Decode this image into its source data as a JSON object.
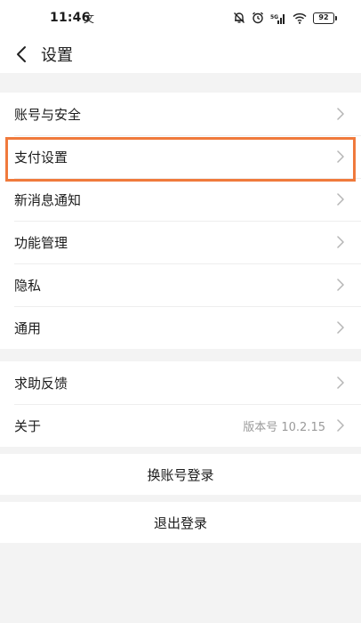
{
  "status_bar": {
    "time": "11:46",
    "app_glyph": "文",
    "battery_level": "92",
    "icons": [
      "bell-off-icon",
      "alarm-icon",
      "signal-icon",
      "wifi-icon",
      "battery-icon"
    ]
  },
  "nav": {
    "title": "设置",
    "back_icon": "chevron-left-icon"
  },
  "group1": {
    "items": [
      {
        "label": "账号与安全"
      },
      {
        "label": "支付设置"
      },
      {
        "label": "新消息通知"
      },
      {
        "label": "功能管理"
      },
      {
        "label": "隐私"
      },
      {
        "label": "通用"
      }
    ]
  },
  "group2": {
    "items": [
      {
        "label": "求助反馈",
        "value": ""
      },
      {
        "label": "关于",
        "value": "版本号 10.2.15"
      }
    ]
  },
  "actions": {
    "switch_account": "换账号登录",
    "logout": "退出登录"
  },
  "colors": {
    "highlight": "#f07a3c",
    "background": "#f3f3f3"
  }
}
